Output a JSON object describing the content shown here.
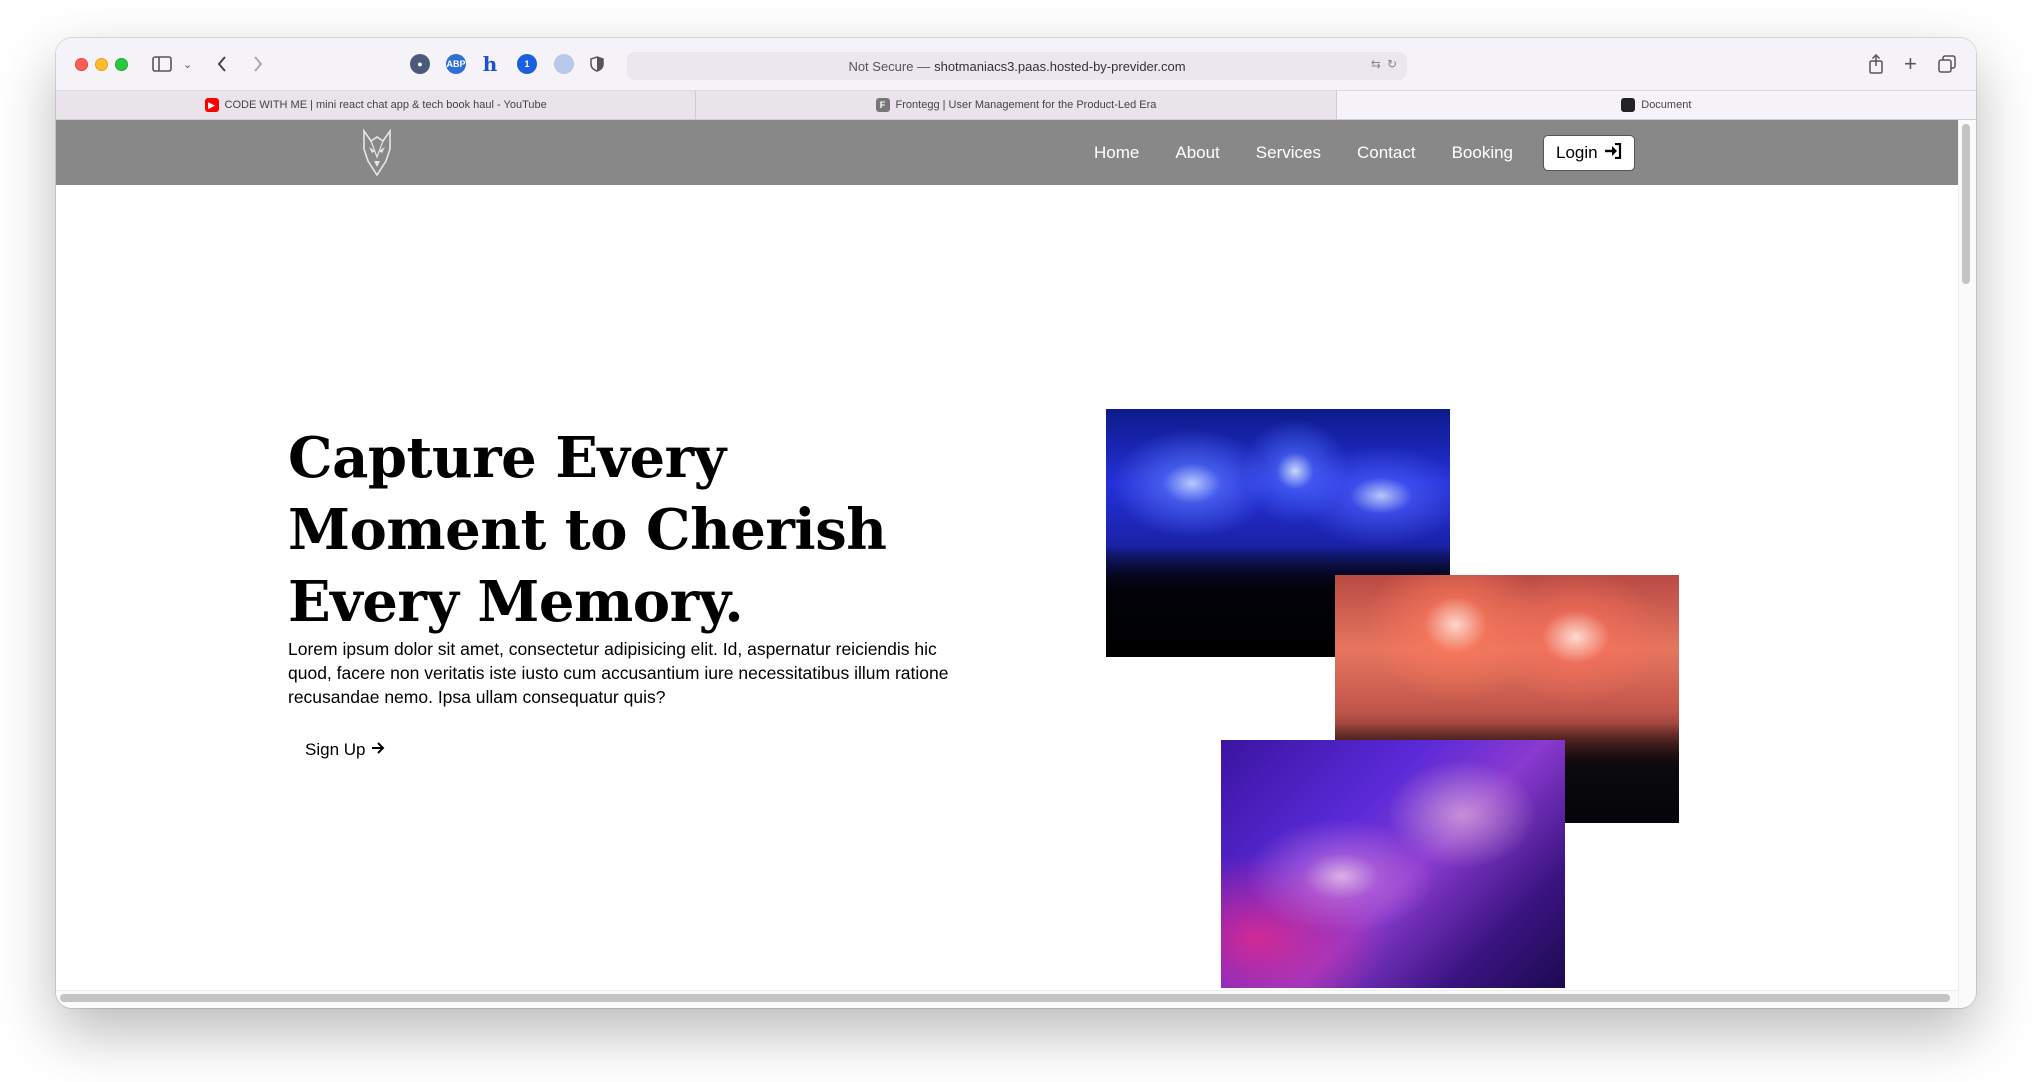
{
  "browser": {
    "address": {
      "security": "Not Secure —",
      "host": "shotmaniacs3.paas.hosted-by-previder.com"
    },
    "tabs": [
      {
        "title": "CODE WITH ME | mini react chat app & tech book haul - YouTube",
        "favicon": "youtube-icon"
      },
      {
        "title": "Frontegg | User Management for the Product-Led Era",
        "favicon": "frontegg-icon"
      },
      {
        "title": "Document",
        "favicon": "document-icon"
      }
    ],
    "extensions": [
      "incognito-icon",
      "adblock-icon",
      "honey-icon",
      "onepassword-icon",
      "extension-icon",
      "shield-icon"
    ]
  },
  "nav": {
    "links": [
      "Home",
      "About",
      "Services",
      "Contact",
      "Booking"
    ],
    "login_label": "Login"
  },
  "hero": {
    "title": "Capture Every Moment to Cherish Every Memory.",
    "text": "Lorem ipsum dolor sit amet, consectetur adipisicing elit. Id, aspernatur reiciendis hic quod, facere non veritatis iste iusto cum accusantium iure necessitatibus illum ratione recusandae nemo. Ipsa ullam consequatur quis?",
    "cta_label": "Sign Up"
  },
  "colors": {
    "navbar": "#888888",
    "text": "#000000"
  }
}
